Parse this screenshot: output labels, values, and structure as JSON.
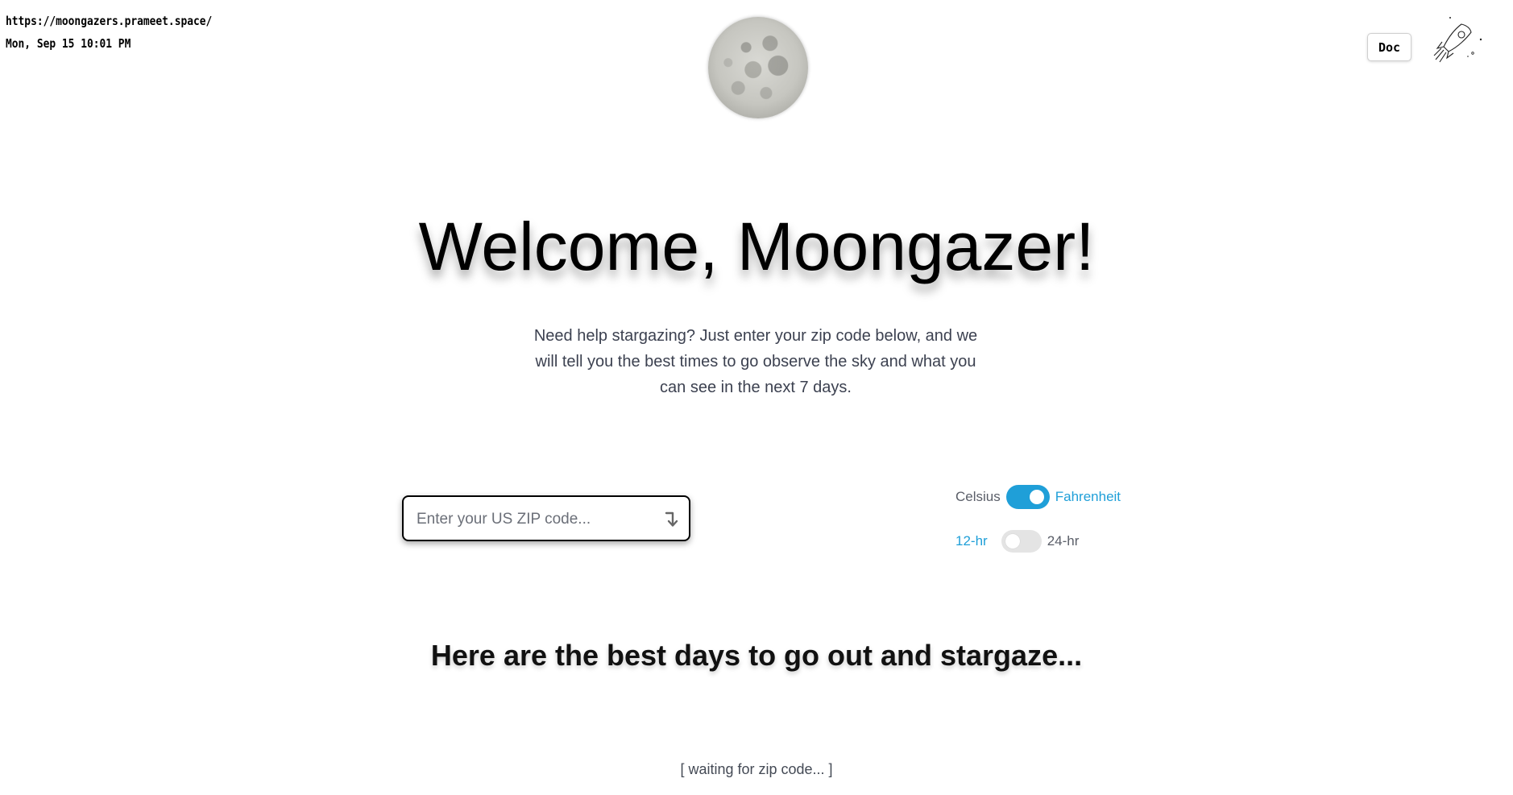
{
  "overlay": {
    "url": "https://moongazers.prameet.space/",
    "datetime": "Mon, Sep 15 10:01 PM"
  },
  "header": {
    "doc_label": "Doc",
    "moon_icon": "moon-image",
    "rocket_icon": "rocket-icon"
  },
  "hero": {
    "title": "Welcome, Moongazer!",
    "intro": "Need help stargazing? Just enter your zip code below, and we will tell you the best times to go observe the sky and what you can see in the next 7 days."
  },
  "search": {
    "placeholder": "Enter your US ZIP code...",
    "value": "",
    "submit_icon": "enter-arrow-icon"
  },
  "settings": {
    "unit_toggle": {
      "left_label": "Celsius",
      "right_label": "Fahrenheit",
      "selected": "Fahrenheit",
      "state": "on"
    },
    "time_toggle": {
      "left_label": "12-hr",
      "right_label": "24-hr",
      "selected": "12-hr",
      "state": "off"
    }
  },
  "results": {
    "heading": "Here are the best days to go out and stargaze...",
    "status": "[ waiting for zip code... ]"
  },
  "colors": {
    "accent": "#1f9fd8",
    "text_muted": "#5a5e68",
    "toggle_off": "#e4e4e4"
  }
}
